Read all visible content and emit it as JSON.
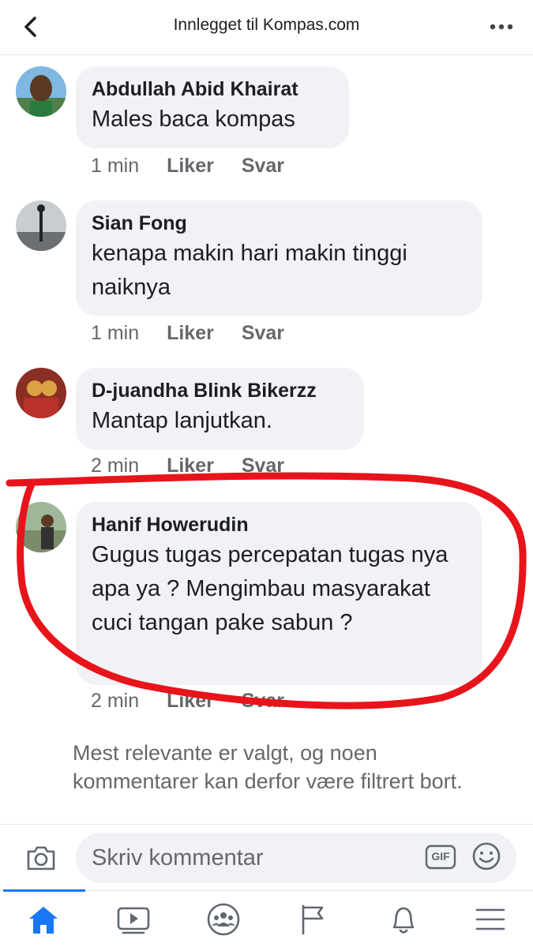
{
  "header": {
    "title": "Innlegget til Kompas.com",
    "back_icon": "chevron-left-icon",
    "more_icon": "more-horizontal-icon"
  },
  "comments": [
    {
      "author": "Abdullah Abid Khairat",
      "text": "Males baca kompas",
      "time": "1 min",
      "like_label": "Liker",
      "reply_label": "Svar"
    },
    {
      "author": "Sian Fong",
      "text": "kenapa makin hari makin tinggi naiknya",
      "time": "1 min",
      "like_label": "Liker",
      "reply_label": "Svar"
    },
    {
      "author": "D-juandha Blink Bikerzz",
      "text": "Mantap lanjutkan.",
      "time": "2 min",
      "like_label": "Liker",
      "reply_label": "Svar"
    },
    {
      "author": "Hanif Howerudin",
      "text": "Gugus tugas percepatan tugas nya apa ya ? Mengimbau masyarakat cuci tangan pake sabun ?",
      "time": "2 min",
      "like_label": "Liker",
      "reply_label": "Svar"
    }
  ],
  "footer_note": "Mest relevante er valgt, og noen kommentarer kan derfor være filtrert bort.",
  "composer": {
    "placeholder": "Skriv kommentar",
    "gif_label": "GIF"
  },
  "tabs": [
    {
      "icon": "home-icon",
      "active": true
    },
    {
      "icon": "video-icon",
      "active": false
    },
    {
      "icon": "groups-icon",
      "active": false
    },
    {
      "icon": "flag-icon",
      "active": false
    },
    {
      "icon": "bell-icon",
      "active": false
    },
    {
      "icon": "menu-icon",
      "active": false
    }
  ],
  "colors": {
    "accent": "#1877f2",
    "bubble": "#f0f2f5",
    "meta_text": "#65676b",
    "annotation": "#e8141b"
  }
}
